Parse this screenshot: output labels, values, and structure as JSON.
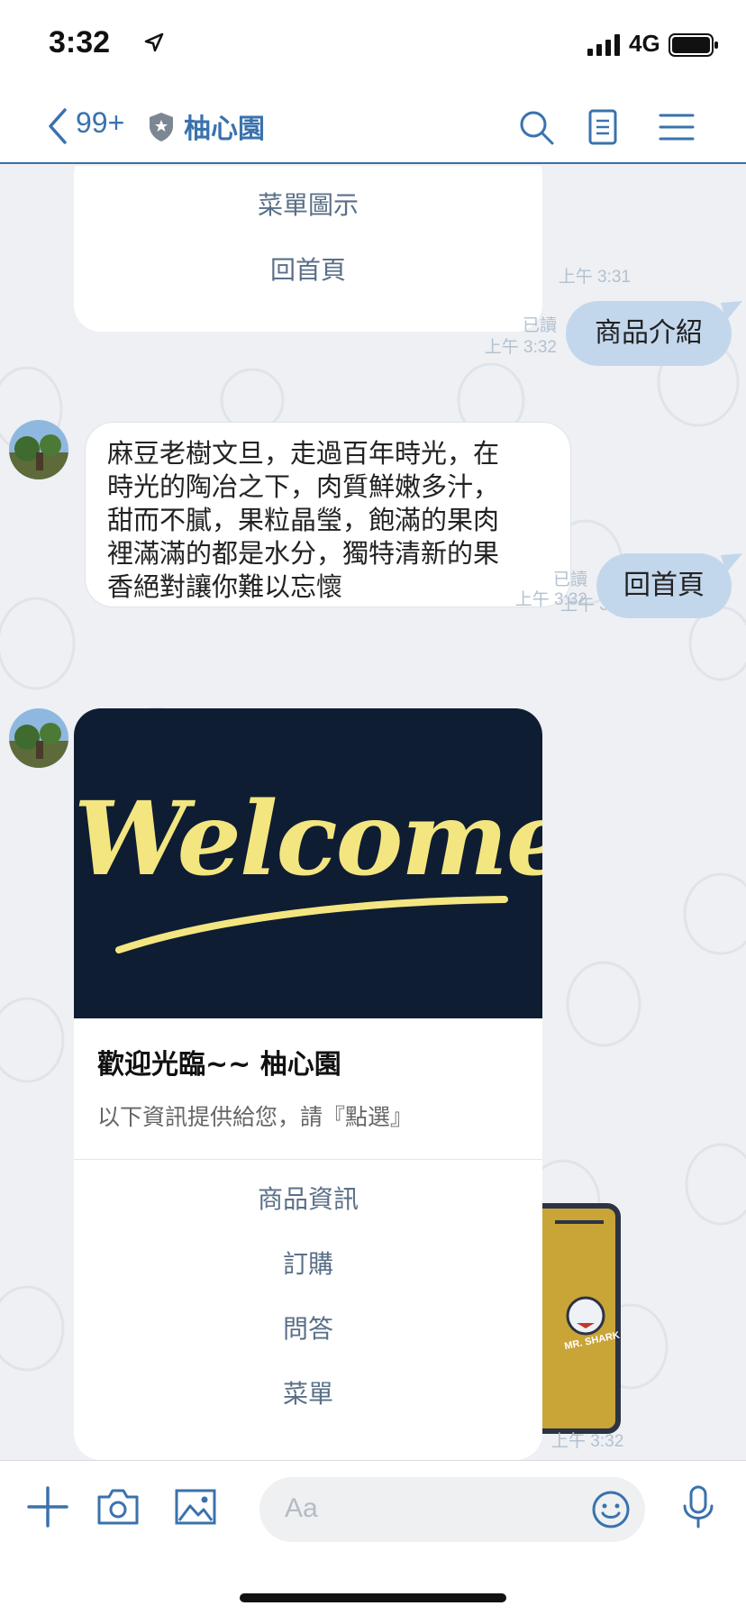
{
  "status_bar": {
    "time": "3:32",
    "network": "4G"
  },
  "header": {
    "unread_count": "99+",
    "title": "柚心園"
  },
  "top_card": {
    "menu": [
      "菜單圖示",
      "回首頁"
    ]
  },
  "messages": [
    {
      "side": "me",
      "text": "商品介紹",
      "read": "已讀",
      "time": "上午 3:32"
    },
    {
      "side": "them",
      "lines": [
        "麻豆老樹文旦，走過百年時光，在",
        "時光的陶冶之下，肉質鮮嫩多汁，",
        "甜而不膩，果粒晶瑩，飽滿的果肉",
        "裡滿滿的都是水分，獨特清新的果",
        "香絕對讓你難以忘懷"
      ]
    },
    {
      "side": "me",
      "text": "回首頁",
      "read": "已讀",
      "time": "上午 3:32"
    }
  ],
  "timestamps": {
    "top_card": "上午 3:31",
    "intro": "上午 3:32",
    "welcome_card": "上午 3:32"
  },
  "welcome_card": {
    "image_text": "Welcome",
    "title": "歡迎光臨~~ 柚心園",
    "subtitle": "以下資訊提供給您，請『點選』",
    "menu": [
      "商品資訊",
      "訂購",
      "問答",
      "菜單"
    ]
  },
  "sticker_text": "MR. SHARK",
  "input": {
    "placeholder": "Aa"
  },
  "colors": {
    "accent": "#3a72ad",
    "my_bubble": "#c3d7ec",
    "welcome_bg": "#0f1d33",
    "welcome_text": "#f3e680"
  },
  "icons": [
    "location-arrow-icon",
    "signal-icon",
    "battery-icon",
    "back-chevron-icon",
    "shield-icon",
    "search-icon",
    "notes-icon",
    "menu-icon",
    "plus-icon",
    "camera-icon",
    "image-icon",
    "emoji-icon",
    "mic-icon"
  ]
}
